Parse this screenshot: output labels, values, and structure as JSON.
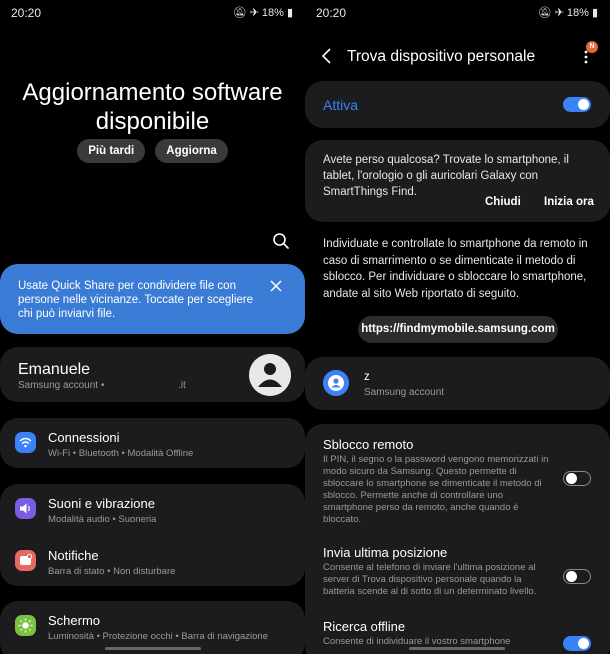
{
  "left": {
    "status": {
      "time": "20:20",
      "battery": "18%"
    },
    "update": {
      "title": "Aggiornamento software disponibile",
      "later": "Più tardi",
      "update": "Aggiorna"
    },
    "quick_share": {
      "text": "Usate Quick Share per condividere file con persone nelle vicinanze. Toccate per scegliere chi può inviarvi file."
    },
    "account": {
      "name": "Emanuele",
      "subtitle": "Samsung account  •",
      "email": ".it"
    },
    "items": [
      {
        "title": "Connessioni",
        "sub": "Wi-Fi  •  Bluetooth  •  Modalità Offline",
        "color": "#3b82f6"
      },
      {
        "title": "Suoni e vibrazione",
        "sub": "Modalità audio  •  Suoneria",
        "color": "#7c5ce0"
      },
      {
        "title": "Notifiche",
        "sub": "Barra di stato  •  Non disturbare",
        "color": "#e46a62"
      },
      {
        "title": "Schermo",
        "sub": "Luminosità  •  Protezione occhi  •  Barra di navigazione",
        "color": "#7cc242"
      }
    ]
  },
  "right": {
    "status": {
      "time": "20:20",
      "battery": "18%"
    },
    "title": "Trova dispositivo personale",
    "badge": "N",
    "active_label": "Attiva",
    "active_on": true,
    "lost_card": {
      "text": "Avete perso qualcosa? Trovate lo smartphone, il tablet, l'orologio o gli auricolari Galaxy con SmartThings Find.",
      "close": "Chiudi",
      "try": "Inizia ora"
    },
    "info": "Individuate e controllate lo smartphone da remoto in caso di smarrimento o se dimenticate il metodo di sblocco. Per individuare o sbloccare lo smartphone, andate al sito Web riportato di seguito.",
    "url": "https://findmymobile.samsung.com",
    "account": {
      "name": "z",
      "subtitle": "Samsung account"
    },
    "options": [
      {
        "title": "Sblocco remoto",
        "desc": "Il PIN, il segno o la password vengono memorizzati in modo sicuro da Samsung. Questo permette di sbloccare lo smartphone se dimenticate il metodo di sblocco. Permette anche di controllare uno smartphone perso da remoto, anche quando è bloccato.",
        "on": false
      },
      {
        "title": "Invia ultima posizione",
        "desc": "Consente al telefono di inviare l'ultima posizione al server di Trova dispositivo personale quando la batteria scende al di sotto di un determinato livello.",
        "on": false
      },
      {
        "title": "Ricerca offline",
        "desc": "Consente di individuare il vostro smartphone",
        "on": true
      }
    ]
  }
}
